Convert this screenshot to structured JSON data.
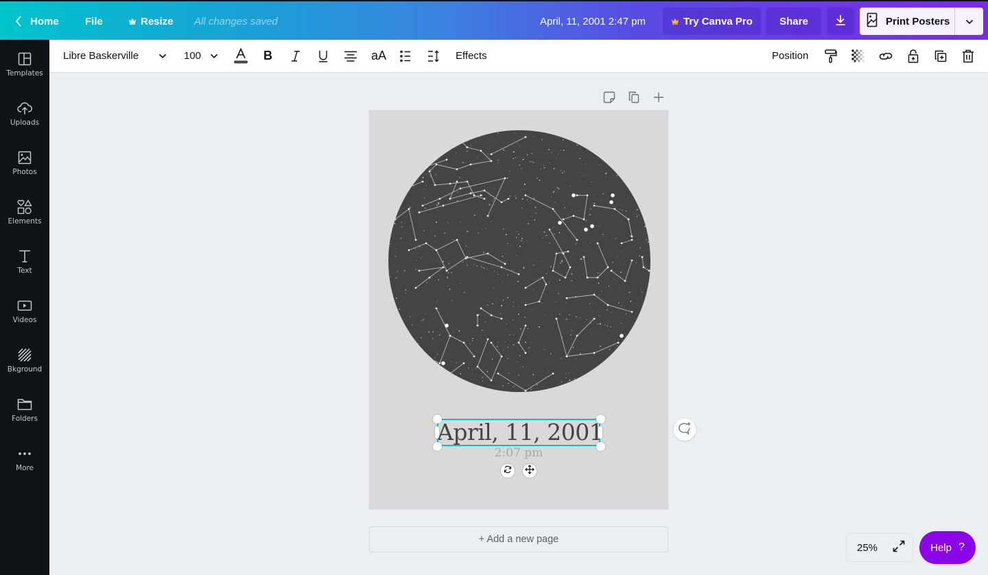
{
  "topbar": {
    "home_label": "Home",
    "file_label": "File",
    "resize_label": "Resize",
    "save_status": "All changes saved",
    "document_title": "April, 11, 2001 2:47 pm",
    "try_pro_label": "Try Canva Pro",
    "share_label": "Share",
    "print_label": "Print Posters"
  },
  "sidebar": {
    "items": [
      {
        "label": "Templates",
        "icon": "templates-icon"
      },
      {
        "label": "Uploads",
        "icon": "cloud-upload-icon"
      },
      {
        "label": "Photos",
        "icon": "photo-icon"
      },
      {
        "label": "Elements",
        "icon": "shapes-icon"
      },
      {
        "label": "Text",
        "icon": "text-icon"
      },
      {
        "label": "Videos",
        "icon": "video-icon"
      },
      {
        "label": "Bkground",
        "icon": "background-icon"
      },
      {
        "label": "Folders",
        "icon": "folder-icon"
      },
      {
        "label": "More",
        "icon": "more-icon"
      }
    ]
  },
  "toolbar": {
    "font_family": "Libre Baskerville",
    "font_size": "100",
    "effects_label": "Effects",
    "position_label": "Position",
    "text_color": "#444444"
  },
  "page": {
    "date_text": "April, 11, 2001",
    "time_text": "2:07 pm",
    "background_color": "#d9d9d9",
    "starmap_color": "#444444"
  },
  "canvas": {
    "add_page_label": "+ Add a new page",
    "zoom_level": "25%"
  },
  "help": {
    "label": "Help",
    "icon_text": "?"
  },
  "colors": {
    "accent_cyan": "#00c4cc",
    "brand_purple": "#7d2ae8",
    "help_purple": "#8b05e8",
    "pro_crown": "#ffc107"
  }
}
